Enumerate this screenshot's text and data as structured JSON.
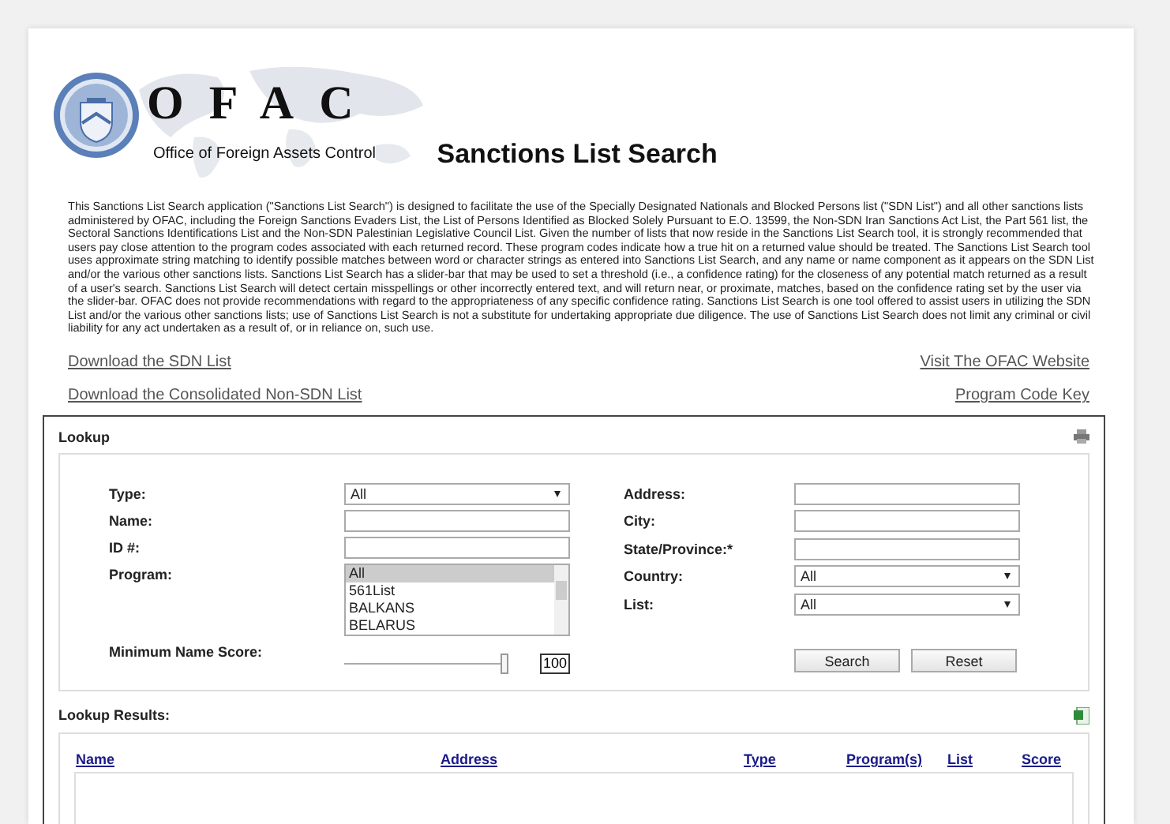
{
  "header": {
    "logo_text": "OFAC",
    "logo_subtitle": "Office of Foreign Assets Control",
    "title": "Sanctions List Search"
  },
  "intro": "This Sanctions List Search application (\"Sanctions List Search\") is designed to facilitate the use of the Specially Designated Nationals and Blocked Persons list (\"SDN List\") and all other sanctions lists administered by OFAC, including the Foreign Sanctions Evaders List, the List of Persons Identified as Blocked Solely Pursuant to E.O. 13599, the Non-SDN Iran Sanctions Act List, the Part 561 list, the Sectoral Sanctions Identifications List and the Non-SDN Palestinian Legislative Council List. Given the number of lists that now reside in the Sanctions List Search tool, it is strongly recommended that users pay close attention to the program codes associated with each returned record. These program codes indicate how a true hit on a returned value should be treated. The Sanctions List Search tool uses approximate string matching to identify possible matches between word or character strings as entered into Sanctions List Search, and any name or name component as it appears on the SDN List and/or the various other sanctions lists. Sanctions List Search has a slider-bar that may be used to set a threshold (i.e., a confidence rating) for the closeness of any potential match returned as a result of a user's search. Sanctions List Search will detect certain misspellings or other incorrectly entered text, and will return near, or proximate, matches, based on the confidence rating set by the user via the slider-bar. OFAC does not provide recommendations with regard to the appropriateness of any specific confidence rating. Sanctions List Search is one tool offered to assist users in utilizing the SDN List and/or the various other sanctions lists; use of Sanctions List Search is not a substitute for undertaking appropriate due diligence. The use of Sanctions List Search does not limit any criminal or civil liability for any act undertaken as a result of, or in reliance on, such use.",
  "links_left": [
    "Download the SDN List",
    "Download the Consolidated Non-SDN List"
  ],
  "links_right": [
    "Visit The OFAC Website",
    "Program Code Key"
  ],
  "lookup": {
    "title": "Lookup",
    "left_fields": [
      {
        "label": "Type:",
        "kind": "select",
        "value": "All"
      },
      {
        "label": "Name:",
        "kind": "text"
      },
      {
        "label": "ID #:",
        "kind": "text"
      },
      {
        "label": "Program:",
        "kind": "listbox",
        "options": [
          {
            "label": "All",
            "selected": true
          },
          {
            "label": "561List",
            "selected": false
          },
          {
            "label": "BALKANS",
            "selected": false
          },
          {
            "label": "BELARUS",
            "selected": false
          }
        ]
      },
      {
        "label": "Minimum Name Score:",
        "kind": "slider",
        "level": 1,
        "value": "100"
      }
    ],
    "right_fields": [
      {
        "label": "Address:",
        "kind": "text"
      },
      {
        "label": "City:",
        "kind": "text"
      },
      {
        "label": "State/Province:*",
        "kind": "text"
      },
      {
        "label": "Country:",
        "kind": "select",
        "value": "All"
      },
      {
        "label": "List:",
        "kind": "select",
        "value": "All"
      }
    ],
    "buttons": [
      "Search",
      "Reset"
    ]
  },
  "results": {
    "title": "Lookup Results:",
    "columns": [
      "Name",
      "Address",
      "Type",
      "Program(s)",
      "List",
      "Score"
    ]
  }
}
